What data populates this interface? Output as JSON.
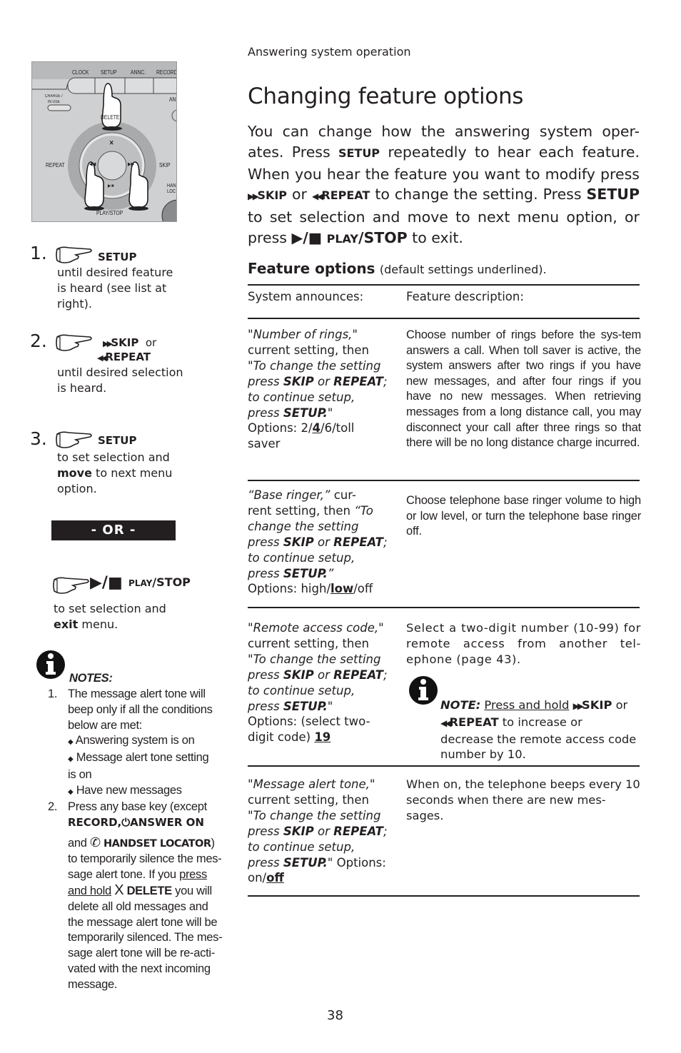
{
  "header": {
    "section": "Answering system operation",
    "title": "Changing feature options"
  },
  "phone_illustration": {
    "buttons": [
      "CLOCK",
      "SETUP",
      "ANNC.",
      "RECORD"
    ],
    "labels": {
      "charge": "CHARGE /",
      "in_use": "IN USE",
      "delete": "DELETE",
      "repeat": "REPEAT",
      "skip": "SKIP",
      "play_stop": "PLAY/STOP",
      "answer": "AN",
      "handset": "HAN",
      "locator": "LOC",
      "x_glyph": "✕",
      "rew_glyph": "◀◀",
      "ff_glyph": "▶▶",
      "playstop_glyph": "▶/■"
    }
  },
  "steps": [
    {
      "number": "1.",
      "button": "SETUP",
      "lines": [
        "until desired feature",
        "is heard (see list at",
        "right)."
      ]
    },
    {
      "number": "2.",
      "button_a": "SKIP",
      "connector": "or",
      "button_b": "REPEAT",
      "lines": [
        "until desired selection",
        "is heard."
      ]
    },
    {
      "number": "3.",
      "button": "SETUP",
      "line1": "to set selection and",
      "line2_bold": "move",
      "line2_rest": " to next menu",
      "line3": "option."
    }
  ],
  "or_divider": "- OR -",
  "play_stop_step": {
    "glyph": "▶/■",
    "label_small": "PLAY",
    "label_large": "/STOP",
    "line1": "to set selection and",
    "line2_bold": "exit",
    "line2_rest": " menu."
  },
  "notes": {
    "title": "NOTES:",
    "note1": {
      "num": "1.",
      "lines": [
        "The message alert tone will",
        "beep only if all the conditions",
        "below are met:"
      ],
      "bullets": [
        "Answering system is on",
        "Message alert tone setting",
        "is on",
        "Have new messages"
      ]
    },
    "note2": {
      "num": "2.",
      "l1": "Press any base key (except",
      "l2_a": "RECORD,",
      "l2_b": "ANSWER ON",
      "l3_a": "and",
      "l3_b": "HANDSET LOCATOR",
      "l3_c": ")",
      "l4": "to temporarily silence the mes-",
      "l5_a": "sage alert tone. If you ",
      "l5_u": "press ",
      "l6_u": "and hold",
      "l6_x": "X",
      "l6_b": "DELETE",
      "l6_c": " you will",
      "l7": "delete all old messages and",
      "l8": "the message alert tone will be",
      "l9": "temporarily silenced. The mes-",
      "l10": "sage alert tone will be re-acti-",
      "l11": "vated with the next incoming",
      "l12": "message."
    }
  },
  "intro": {
    "p1": "You can change how the answering system oper-ates. Press ",
    "setup_small": "SETUP",
    "p2": " repeatedly to hear each feature. When you hear the feature you want to modify press ",
    "skip": "SKIP",
    "or": " or ",
    "repeat": "REPEAT",
    "p3": " to change the setting. Press ",
    "setup_bold": "SETUP",
    "p4": " to set selection and move to next menu option, or press ",
    "play_glyph": "▶/■",
    "play_small": "PLAY",
    "stop": "/STOP",
    "p5": " to exit."
  },
  "feature_options": {
    "heading": "Feature options",
    "subheading": "(default settings underlined).",
    "col_headers": [
      "System announces:",
      "Feature description:"
    ],
    "rows": [
      {
        "announce_quote": "\"Number of rings,\"",
        "current": "current setting, then",
        "change_a": "\"To change the setting",
        "press": "press ",
        "skip": "SKIP",
        "or": " or ",
        "repeat": "REPEAT",
        "semi": ";",
        "continue": "to continue setup,",
        "press2": "press ",
        "setup": "SETUP.",
        "close": "\"",
        "options_pre": "Options: 2/",
        "options_default": "4",
        "options_post": "/6/toll",
        "options_tail": "saver",
        "description": "Choose number of rings before the sys-tem answers a call. When toll saver is active, the system answers after two rings if you have new messages, and after four rings if you have no new messages. When retrieving messages from a long distance call, you may disconnect your call after three rings so that there will be no long distance charge incurred."
      },
      {
        "announce_quote": "“Base ringer,”",
        "cur": " cur-",
        "rent": "rent setting, then ",
        "change_a": "“To",
        "change_b": "change the setting",
        "press": "press ",
        "skip": "SKIP",
        "or": " or ",
        "repeat": "REPEAT",
        "semi": ";",
        "continue": "to continue setup,",
        "press2": "press ",
        "setup": "SETUP.",
        "close": "”",
        "options_pre": "Options: high/",
        "options_default": "low",
        "options_post": "/off",
        "description": "Choose telephone base ringer volume to high or low level, or turn the telephone base ringer off."
      },
      {
        "announce_quote": "\"Remote access code,\"",
        "current": "current setting, then",
        "change_a": "\"To change the setting",
        "press": "press ",
        "skip": "SKIP",
        "or": " or ",
        "repeat": "REPEAT",
        "semi": ";",
        "continue": "to continue setup,",
        "press2": "press ",
        "setup": "SETUP.",
        "close": "\"",
        "options_pre": "Options: (select two-",
        "options_tail": "digit code) ",
        "options_default": "19",
        "description": "Select a two-digit number (10-99) for remote access from another tel-ephone (page 43).",
        "note": {
          "label": "NOTE:",
          "underlined": "Press and hold",
          "skip": "SKIP",
          "or": " or",
          "repeat": "REPEAT",
          "rest1": " to increase or",
          "rest2": "decrease the remote access code",
          "rest3": "number by 10."
        }
      },
      {
        "announce_quote": "\"Message alert tone,\"",
        "current": "current setting, then",
        "change_a": "\"To change the setting",
        "press": "press ",
        "skip": "SKIP",
        "or": " or ",
        "repeat": "REPEAT",
        "semi": ";",
        "continue": "to continue setup,",
        "press2": "press ",
        "setup": "SETUP.",
        "close": "\" Options:",
        "options_pre": "on/",
        "options_default": "off",
        "description": "When on, the telephone beeps every 10 seconds when there are new mes-sages."
      }
    ]
  },
  "page_number": "38"
}
